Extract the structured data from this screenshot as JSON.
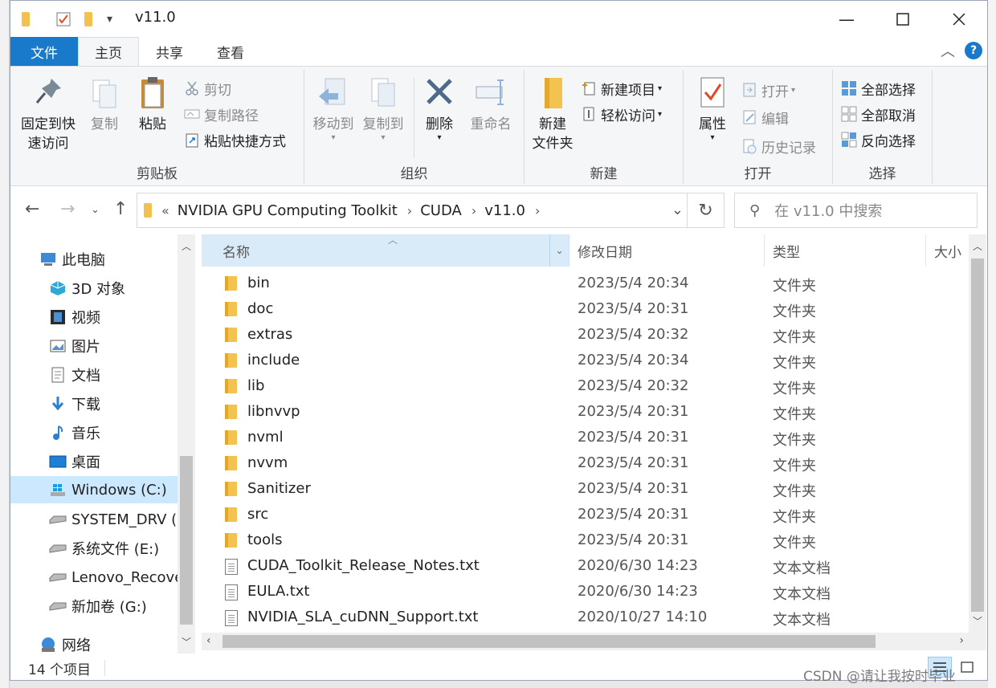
{
  "window": {
    "title": "v11.0"
  },
  "tabs": {
    "file": "文件",
    "home": "主页",
    "share": "共享",
    "view": "查看"
  },
  "ribbon": {
    "clipboard": {
      "label": "剪贴板",
      "pin_line1": "固定到快",
      "pin_line2": "速访问",
      "copy": "复制",
      "paste": "粘贴",
      "cut": "剪切",
      "copy_path": "复制路径",
      "paste_shortcut": "粘贴快捷方式"
    },
    "organize": {
      "label": "组织",
      "move_to": "移动到",
      "copy_to": "复制到",
      "delete": "删除",
      "rename": "重命名"
    },
    "new": {
      "label": "新建",
      "new_folder_line1": "新建",
      "new_folder_line2": "文件夹",
      "new_item": "新建项目",
      "easy_access": "轻松访问"
    },
    "open": {
      "label": "打开",
      "properties": "属性",
      "open": "打开",
      "edit": "编辑",
      "history": "历史记录"
    },
    "select": {
      "label": "选择",
      "select_all": "全部选择",
      "select_none": "全部取消",
      "invert": "反向选择"
    }
  },
  "address": {
    "overflow": "«",
    "crumbs": [
      "NVIDIA GPU Computing Toolkit",
      "CUDA",
      "v11.0"
    ],
    "search_placeholder": "在 v11.0 中搜索"
  },
  "nav": {
    "this_pc": "此电脑",
    "items": [
      "3D 对象",
      "视频",
      "图片",
      "文档",
      "下载",
      "音乐",
      "桌面",
      "Windows (C:)",
      "SYSTEM_DRV (I",
      "系统文件 (E:)",
      "Lenovo_Recove",
      "新加卷 (G:)"
    ],
    "network": "网络"
  },
  "columns": {
    "name": "名称",
    "date": "修改日期",
    "type": "类型",
    "size": "大小"
  },
  "files": [
    {
      "name": "bin",
      "date": "2023/5/4 20:34",
      "type": "文件夹",
      "icon": "folder-icon"
    },
    {
      "name": "doc",
      "date": "2023/5/4 20:31",
      "type": "文件夹",
      "icon": "folder-icon"
    },
    {
      "name": "extras",
      "date": "2023/5/4 20:32",
      "type": "文件夹",
      "icon": "folder-icon"
    },
    {
      "name": "include",
      "date": "2023/5/4 20:34",
      "type": "文件夹",
      "icon": "folder-icon"
    },
    {
      "name": "lib",
      "date": "2023/5/4 20:32",
      "type": "文件夹",
      "icon": "folder-icon"
    },
    {
      "name": "libnvvp",
      "date": "2023/5/4 20:31",
      "type": "文件夹",
      "icon": "folder-icon"
    },
    {
      "name": "nvml",
      "date": "2023/5/4 20:31",
      "type": "文件夹",
      "icon": "folder-icon"
    },
    {
      "name": "nvvm",
      "date": "2023/5/4 20:31",
      "type": "文件夹",
      "icon": "folder-icon"
    },
    {
      "name": "Sanitizer",
      "date": "2023/5/4 20:31",
      "type": "文件夹",
      "icon": "folder-icon"
    },
    {
      "name": "src",
      "date": "2023/5/4 20:31",
      "type": "文件夹",
      "icon": "folder-icon"
    },
    {
      "name": "tools",
      "date": "2023/5/4 20:31",
      "type": "文件夹",
      "icon": "folder-icon"
    },
    {
      "name": "CUDA_Toolkit_Release_Notes.txt",
      "date": "2020/6/30 14:23",
      "type": "文本文档",
      "icon": "text-file-icon"
    },
    {
      "name": "EULA.txt",
      "date": "2020/6/30 14:23",
      "type": "文本文档",
      "icon": "text-file-icon"
    },
    {
      "name": "NVIDIA_SLA_cuDNN_Support.txt",
      "date": "2020/10/27 14:10",
      "type": "文本文档",
      "icon": "text-file-icon"
    }
  ],
  "status": {
    "count": "14 个项目"
  },
  "watermark": "CSDN @请让我按时毕业",
  "colors": {
    "accent": "#1979ca",
    "selection": "#cce8ff",
    "header_sel": "#d9ebf9"
  }
}
